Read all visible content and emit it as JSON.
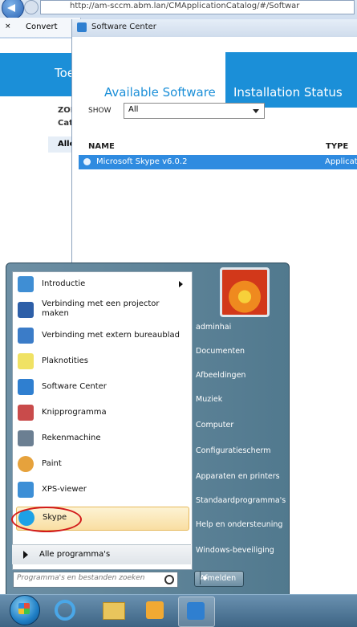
{
  "browser": {
    "address": "http://am-sccm.abm.lan/CMApplicationCatalog/#/Softwar",
    "tab_label": "Convert"
  },
  "web": {
    "header_fragment": "Toe",
    "cat1": "ZOE",
    "cat2": "Cate",
    "cat3": "Alle"
  },
  "software_center": {
    "title": "Software Center",
    "tabs": [
      "Available Software",
      "Installation Status"
    ],
    "show_label": "SHOW",
    "show_value": "All",
    "columns": {
      "name": "NAME",
      "type": "TYPE"
    },
    "rows": [
      {
        "name": "Microsoft Skype  v6.0.2",
        "type": "Applicat"
      }
    ]
  },
  "start_menu": {
    "programs": [
      {
        "label": "Introductie",
        "icon": "introduction-icon",
        "arrow": true
      },
      {
        "label": "Verbinding met een projector maken",
        "icon": "projector-icon"
      },
      {
        "label": "Verbinding met extern bureaublad",
        "icon": "remote-desktop-icon"
      },
      {
        "label": "Plaknotities",
        "icon": "sticky-notes-icon"
      },
      {
        "label": "Software Center",
        "icon": "software-center-icon"
      },
      {
        "label": "Knipprogramma",
        "icon": "snipping-tool-icon"
      },
      {
        "label": "Rekenmachine",
        "icon": "calculator-icon"
      },
      {
        "label": "Paint",
        "icon": "paint-icon"
      },
      {
        "label": "XPS-viewer",
        "icon": "xps-viewer-icon"
      },
      {
        "label": "Skype",
        "icon": "skype-icon",
        "highlighted": true
      }
    ],
    "all_programs": "Alle programma's",
    "search_placeholder": "Programma's en bestanden zoeken",
    "right_items": [
      "adminhai",
      "Documenten",
      "Afbeeldingen",
      "Muziek",
      "Computer",
      "Configuratiescherm",
      "Apparaten en printers",
      "Standaardprogramma's",
      "Help en ondersteuning",
      "Windows-beveiliging"
    ],
    "shutdown": "Afmelden"
  },
  "taskbar": {
    "items": [
      "start-orb",
      "internet-explorer-icon",
      "windows-explorer-icon",
      "outlook-icon",
      "software-center-icon"
    ]
  },
  "colors": {
    "accent": "#1b8fd8",
    "selection": "#2f8be0",
    "annotation": "#d21a1a"
  }
}
